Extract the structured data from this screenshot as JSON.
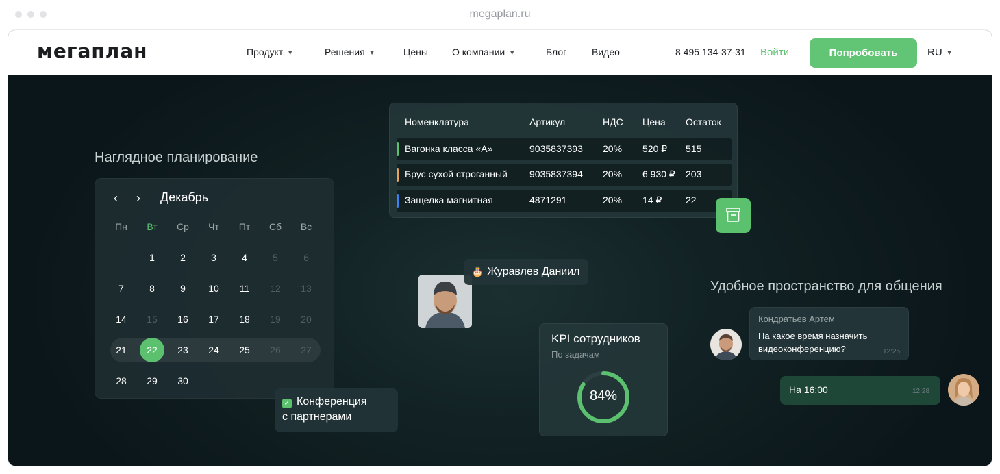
{
  "browser": {
    "url": "megaplan.ru"
  },
  "nav": {
    "logo": "мегаплан",
    "items": [
      "Продукт",
      "Решения",
      "Цены",
      "О компании",
      "Блог",
      "Видео"
    ],
    "phone": "8 495 134-37-31",
    "login": "Войти",
    "try": "Попробовать",
    "lang": "RU"
  },
  "planning": {
    "heading": "Наглядное планирование",
    "month": "Декабрь",
    "weekdays": [
      "Пн",
      "Вт",
      "Ср",
      "Чт",
      "Пт",
      "Сб",
      "Вс"
    ],
    "days": [
      "1",
      "2",
      "3",
      "4",
      "5",
      "6",
      "7",
      "8",
      "9",
      "10",
      "11",
      "12",
      "13",
      "14",
      "15",
      "16",
      "17",
      "18",
      "19",
      "20",
      "21",
      "22",
      "23",
      "24",
      "25",
      "26",
      "27",
      "28",
      "29",
      "30"
    ],
    "selected_day": "22",
    "event": "Конференция\nс партнерами"
  },
  "table": {
    "headers": [
      "Номенклатура",
      "Артикул",
      "НДС",
      "Цена",
      "Остаток"
    ],
    "rows": [
      [
        "Вагонка класса «А»",
        "9035837393",
        "20%",
        "520 ₽",
        "515"
      ],
      [
        "Брус сухой строганный",
        "9035837394",
        "20%",
        "6 930 ₽",
        "203"
      ],
      [
        "Защелка магнитная",
        "4871291",
        "20%",
        "14 ₽",
        "22"
      ]
    ],
    "row_colors": [
      "#5bc16f",
      "#e9a25a",
      "#3b82f6"
    ]
  },
  "person": {
    "name": "Журавлев Даниил"
  },
  "kpi": {
    "title": "KPI  сотрудников",
    "subtitle": "По задачам",
    "value": "84%",
    "fraction": 0.84
  },
  "chat": {
    "heading": "Удобное пространство для общения",
    "msg1": {
      "author": "Кондратьев Артем",
      "text": "На какое время назначить видеоконференцию?",
      "time": "12:25"
    },
    "msg2": {
      "text": "На 16:00",
      "time": "12:28"
    }
  },
  "colors": {
    "accent": "#5bc16f",
    "hero_bg": "#0d1a1d"
  }
}
